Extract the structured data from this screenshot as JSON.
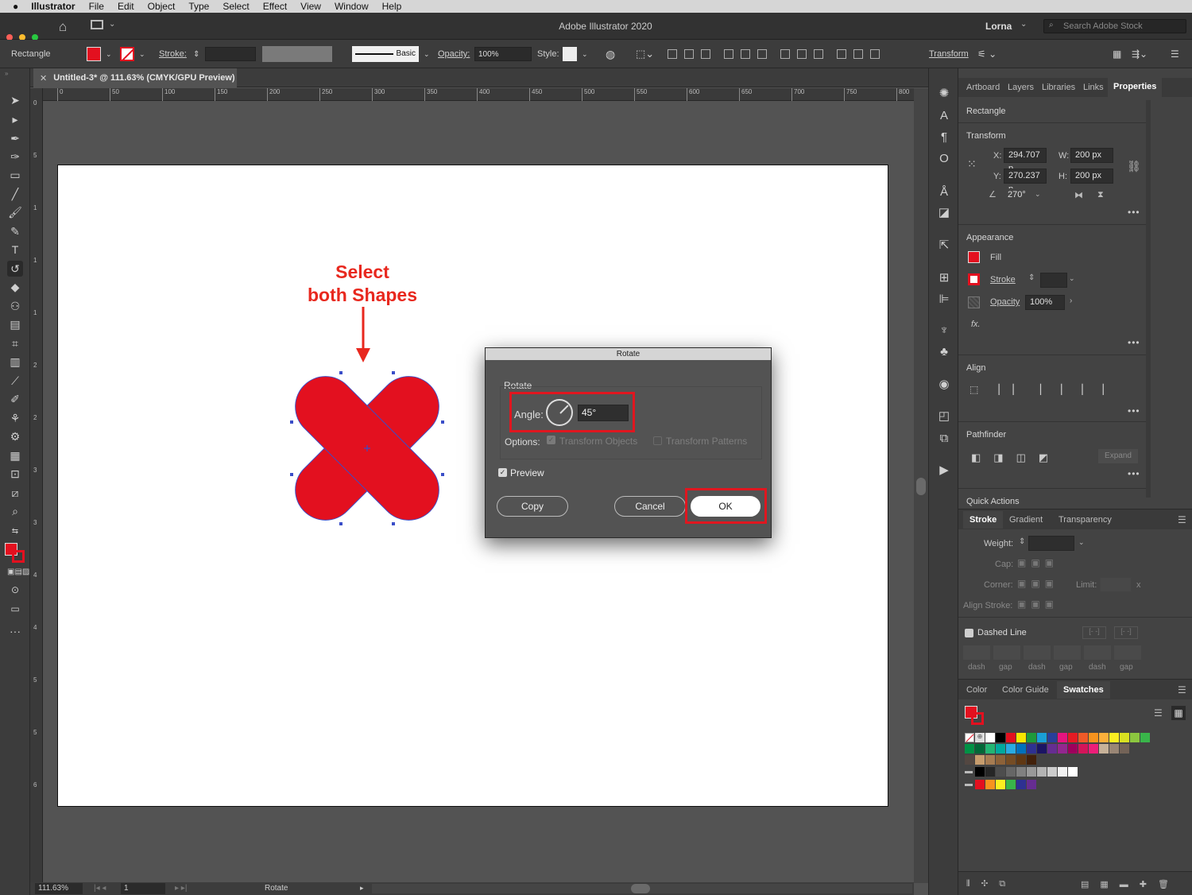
{
  "menubar": {
    "app": "Illustrator",
    "items": [
      "File",
      "Edit",
      "Object",
      "Type",
      "Select",
      "Effect",
      "View",
      "Window",
      "Help"
    ]
  },
  "titlebar": {
    "title": "Adobe Illustrator 2020",
    "user": "Lorna",
    "search_placeholder": "Search Adobe Stock"
  },
  "control_bar": {
    "selection": "Rectangle",
    "stroke_label": "Stroke:",
    "brush": "Basic",
    "opacity_label": "Opacity:",
    "opacity_value": "100%",
    "style_label": "Style:",
    "transform_label": "Transform"
  },
  "document": {
    "tab_title": "Untitled-3* @ 111.63% (CMYK/GPU Preview)",
    "ruler_ticks": [
      "0",
      "50",
      "100",
      "150",
      "200",
      "250",
      "300",
      "350",
      "400",
      "450",
      "500",
      "550",
      "600",
      "650",
      "700",
      "750",
      "800"
    ],
    "vruler_ticks": [
      "0",
      "5",
      "1",
      "1",
      "1",
      "2",
      "2",
      "3",
      "3",
      "4",
      "4",
      "5",
      "5",
      "6"
    ]
  },
  "status": {
    "zoom": "111.63%",
    "artboard": "1",
    "tool": "Rotate"
  },
  "annotation": {
    "line1": "Select",
    "line2": "both Shapes",
    "color": "#e8281e"
  },
  "shape": {
    "fill": "#e3101f",
    "outline": "#3a4ec8"
  },
  "dialog": {
    "title": "Rotate",
    "section": "Rotate",
    "angle_label": "Angle:",
    "angle_value": "45°",
    "options_label": "Options:",
    "transform_objects": "Transform Objects",
    "transform_patterns": "Transform Patterns",
    "preview": "Preview",
    "copy": "Copy",
    "cancel": "Cancel",
    "ok": "OK"
  },
  "properties": {
    "tabs": [
      "Artboard",
      "Layers",
      "Libraries",
      "Links",
      "Properties"
    ],
    "object": "Rectangle",
    "transform": {
      "title": "Transform",
      "x_label": "X:",
      "x": "294.707 p",
      "y_label": "Y:",
      "y": "270.237 p",
      "w_label": "W:",
      "w": "200 px",
      "h_label": "H:",
      "h": "200 px",
      "angle": "270°"
    },
    "appearance": {
      "title": "Appearance",
      "fill": "Fill",
      "stroke": "Stroke",
      "opacity": "Opacity",
      "opacity_value": "100%",
      "fx": "fx."
    },
    "align": "Align",
    "pathfinder": "Pathfinder",
    "expand": "Expand",
    "quick_actions": "Quick Actions"
  },
  "stroke_panel": {
    "tabs": [
      "Stroke",
      "Gradient",
      "Transparency"
    ],
    "weight": "Weight:",
    "cap": "Cap:",
    "corner": "Corner:",
    "limit": "Limit:",
    "limit_unit": "x",
    "align_stroke": "Align Stroke:",
    "dashed_line": "Dashed Line",
    "dash_labels": [
      "dash",
      "gap",
      "dash",
      "gap",
      "dash",
      "gap"
    ]
  },
  "color_panel": {
    "tabs": [
      "Color",
      "Color Guide",
      "Swatches"
    ]
  },
  "swatches": {
    "row1": [
      "#ffffff",
      "#000000",
      "#e3101f",
      "#f7e600",
      "#1e9a3b",
      "#1a9fd6",
      "#283f9a",
      "#e5147f",
      "#e51b24",
      "#f05a28",
      "#f7931e",
      "#fbb03b",
      "#fcee21",
      "#d9e021",
      "#8cc63f",
      "#39b54a"
    ],
    "row2": [
      "#009245",
      "#006837",
      "#22b573",
      "#00a99d",
      "#29abe2",
      "#0071bc",
      "#2e3192",
      "#1b1464",
      "#662d91",
      "#93278f",
      "#9e005d",
      "#d4145a",
      "#ed1e79",
      "#c7b299",
      "#998675",
      "#736357"
    ],
    "row3": [
      "#534741",
      "#c69c6d",
      "#a67c52",
      "#8c6239",
      "#754c24",
      "#603813",
      "#42210b"
    ],
    "row4": [
      "#000000",
      "#262626",
      "#4d4d4d",
      "#666666",
      "#808080",
      "#999999",
      "#b3b3b3",
      "#cccccc",
      "#f2f2f2",
      "#ffffff"
    ],
    "row5": [
      "#e3101f",
      "#f7931e",
      "#fcee21",
      "#39b54a",
      "#2e3192",
      "#662d91"
    ]
  }
}
